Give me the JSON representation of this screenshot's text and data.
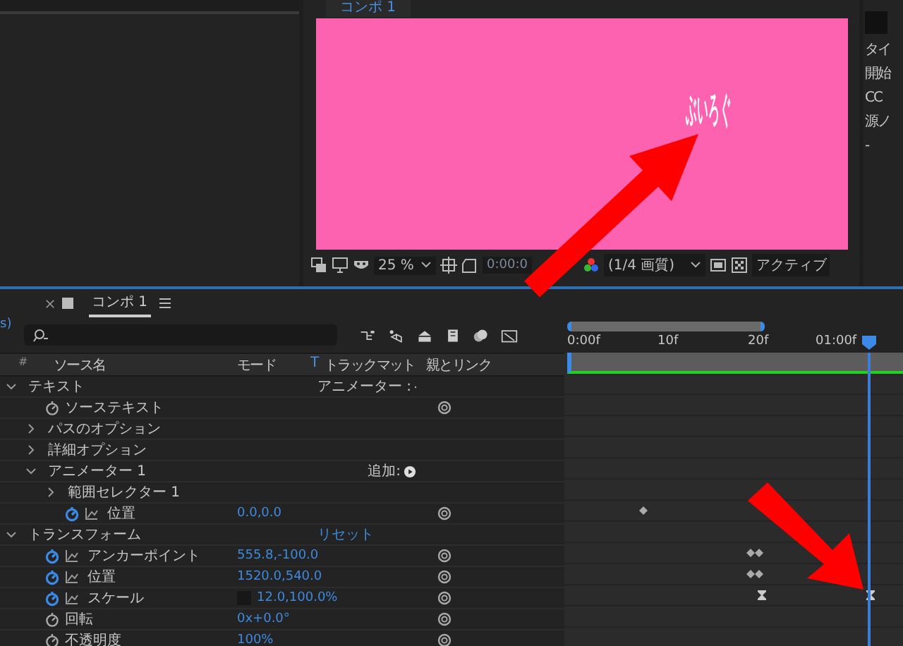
{
  "viewer": {
    "tab": "コンポ 1",
    "canvas_text": "ぶいろぐ",
    "zoom": "25 %",
    "timecode": "0:00:0",
    "resolution": "(1/4 画質)",
    "view": "アクティブ"
  },
  "side_panel": {
    "texts": [
      "タイ",
      "開始",
      "CC",
      "源ノ",
      "-"
    ]
  },
  "timeline": {
    "tab": "コンポ 1",
    "fragment": "s)",
    "columns": [
      "#",
      "ソース名",
      "モード",
      "T",
      "トラックマット",
      "親とリンク"
    ],
    "ruler_labels": [
      "0:00f",
      "10f",
      "20f",
      "01:00f"
    ],
    "work_area": {
      "level": 0.56
    },
    "playhead": {
      "level": 0.9
    }
  },
  "layers": [
    {
      "label": "テキスト",
      "expanded": true,
      "action": {
        "text": "アニメーター :",
        "kind": "menu"
      },
      "children": [
        {
          "label": "ソーステキスト",
          "stopwatch": false,
          "pickwhip": true
        },
        {
          "label": "パスのオプション",
          "expanded": false
        },
        {
          "label": "詳細オプション",
          "expanded": false
        },
        {
          "label": "アニメーター 1",
          "expanded": true,
          "action": {
            "text": "追加:",
            "kind": "menu"
          },
          "children": [
            {
              "label": "範囲セレクター 1",
              "expanded": false
            },
            {
              "label": "位置",
              "stopwatch": true,
              "graph": true,
              "value": "0.0,0.0",
              "pickwhip": true,
              "keyframes": [
                {
                  "kind": "diamond",
                  "level": 0.23
                }
              ]
            }
          ]
        }
      ]
    },
    {
      "label": "トランスフォーム",
      "expanded": true,
      "action": {
        "text": "リセット",
        "kind": "link"
      },
      "children": [
        {
          "label": "アンカーポイント",
          "stopwatch": true,
          "graph": true,
          "value": "555.8,-100.0",
          "pickwhip": true,
          "keyframes": [
            {
              "kind": "double",
              "level": 0.56
            }
          ]
        },
        {
          "label": "位置",
          "stopwatch": true,
          "graph": true,
          "value": "1520.0,540.0",
          "pickwhip": true,
          "keyframes": [
            {
              "kind": "double",
              "level": 0.56
            }
          ]
        },
        {
          "label": "スケール",
          "stopwatch": true,
          "graph": true,
          "value": "12.0,100.0%",
          "constrain": true,
          "pickwhip": true,
          "keyframes": [
            {
              "kind": "hourglass",
              "level": 0.58
            },
            {
              "kind": "hourglass",
              "level": 0.9
            }
          ]
        },
        {
          "label": "回転",
          "stopwatch": false,
          "value": "0x+0.0°",
          "pickwhip": true
        },
        {
          "label": "不透明度",
          "stopwatch": false,
          "value": "100%",
          "pickwhip": true
        }
      ]
    }
  ]
}
